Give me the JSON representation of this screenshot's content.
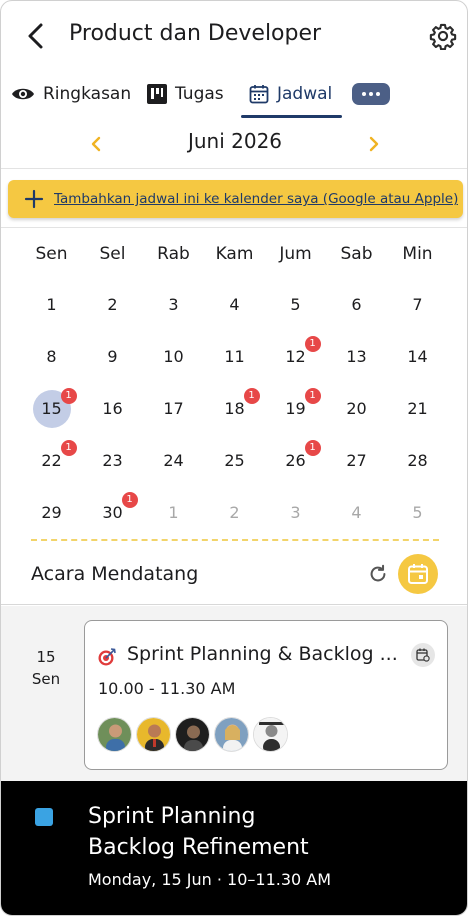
{
  "header": {
    "title": "Product dan Developer"
  },
  "tabs": [
    {
      "label": "Ringkasan",
      "icon": "eye-icon"
    },
    {
      "label": "Tugas",
      "icon": "board-icon"
    },
    {
      "label": "Jadwal",
      "icon": "calendar-icon",
      "active": true
    }
  ],
  "month": {
    "label": "Juni 2026"
  },
  "banner": {
    "text": "Tambahkan jadwal ini ke kalender saya (Google atau Apple)"
  },
  "calendar": {
    "weekdays": [
      "Sen",
      "Sel",
      "Rab",
      "Kam",
      "Jum",
      "Sab",
      "Min"
    ],
    "days": [
      {
        "d": "1"
      },
      {
        "d": "2"
      },
      {
        "d": "3"
      },
      {
        "d": "4"
      },
      {
        "d": "5"
      },
      {
        "d": "6"
      },
      {
        "d": "7"
      },
      {
        "d": "8"
      },
      {
        "d": "9"
      },
      {
        "d": "10"
      },
      {
        "d": "11"
      },
      {
        "d": "12",
        "badge": "1"
      },
      {
        "d": "13"
      },
      {
        "d": "14"
      },
      {
        "d": "15",
        "badge": "1",
        "today": true
      },
      {
        "d": "16"
      },
      {
        "d": "17"
      },
      {
        "d": "18",
        "badge": "1"
      },
      {
        "d": "19",
        "badge": "1"
      },
      {
        "d": "20"
      },
      {
        "d": "21"
      },
      {
        "d": "22",
        "badge": "1"
      },
      {
        "d": "23"
      },
      {
        "d": "24"
      },
      {
        "d": "25"
      },
      {
        "d": "26",
        "badge": "1"
      },
      {
        "d": "27"
      },
      {
        "d": "28"
      },
      {
        "d": "29"
      },
      {
        "d": "30",
        "badge": "1"
      },
      {
        "d": "1",
        "muted": true
      },
      {
        "d": "2",
        "muted": true
      },
      {
        "d": "3",
        "muted": true
      },
      {
        "d": "4",
        "muted": true
      },
      {
        "d": "5",
        "muted": true
      }
    ]
  },
  "upcoming": {
    "title": "Acara Mendatang",
    "event": {
      "day": "15",
      "weekday": "Sen",
      "title": "Sprint Planning & Backlog ...",
      "time": "10.00 - 11.30 AM",
      "attendee_count": 5
    }
  },
  "toast": {
    "title_line1": "Sprint Planning",
    "title_line2": "Backlog Refinement",
    "subtitle": "Monday, 15 Jun · 10–11.30 AM",
    "color": "#3aa3e3"
  },
  "colors": {
    "accent_navy": "#1f3a68",
    "accent_yellow": "#f5c842",
    "badge_red": "#e74848",
    "today_circle": "#c3cde6"
  }
}
